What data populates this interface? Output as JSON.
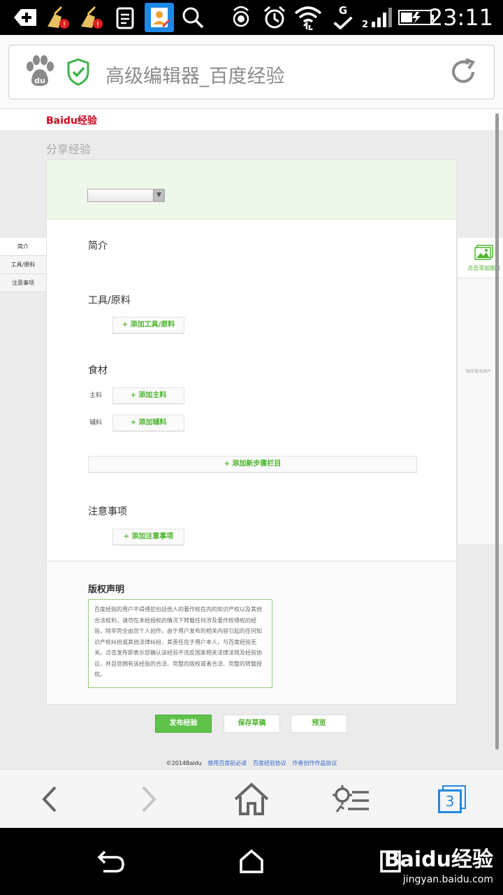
{
  "status_bar": {
    "time": "23:11",
    "network": "G",
    "icons": [
      "add-app-icon",
      "cleaner-icon",
      "cleaner-icon",
      "clipboard-icon",
      "contacts-app-icon",
      "search-icon",
      "hotspot-icon",
      "alarm-icon",
      "wifi-icon",
      "check-icon",
      "signal-icon",
      "battery-icon"
    ]
  },
  "browser": {
    "url_title": "高级编辑器_百度经验",
    "nav_icons": [
      "back-icon",
      "forward-icon",
      "home-icon",
      "menu-icon",
      "tabs-icon"
    ],
    "tab_count": "3"
  },
  "page": {
    "logo": "Baidu经验",
    "title": "分享经验",
    "left_nav": [
      "简介",
      "工具/原料",
      "注意事项"
    ],
    "sections": {
      "intro": "简介",
      "tools": "工具/原料",
      "add_tools": "+ 添加工具/原料",
      "ingredients": "食材",
      "main_label": "主料",
      "add_main": "+ 添加主料",
      "aux_label": "辅料",
      "add_aux": "+ 添加辅料",
      "add_step": "+ 添加新步骤栏目",
      "notes": "注意事项",
      "add_notes": "+ 添加注意事项",
      "copyright": "版权声明"
    },
    "copyright_text": "百度经验的用户不得侵犯包括他人的著作权在内的知识产权以及其他合法权利，请勿在未经授权的情况下转载任何涉及著作权侵权的经验，除非完全由您个人创作。由于用户发布的相关内容引起的任何知识产权纠纷或其他法律纠纷，其责任在于用户本人，与百度经验无关。点击发布即表示您确认该经验不违反国家相关法律法规及经验协议，并且您拥有该经验的合法、完整的版权或者合法、完整的转载授权。",
    "right_panel": {
      "add_image": "点击添加图片",
      "empty": "图库暂无图片"
    },
    "buttons": {
      "publish": "发布经验",
      "save_draft": "保存草稿",
      "preview": "预览"
    },
    "footer": {
      "copyright": "©2014Baidu",
      "link1": "使用百度前必读",
      "link2": "百度经验协议",
      "link3": "作者创作作品协议"
    }
  },
  "watermark": {
    "brand": "Baidu经验",
    "url": "jingyan.baidu.com"
  },
  "colors": {
    "accent_green": "#5fc24a",
    "link_blue": "#3366cc",
    "logo_red": "#d0021b",
    "logo_blue": "#2932e1"
  }
}
